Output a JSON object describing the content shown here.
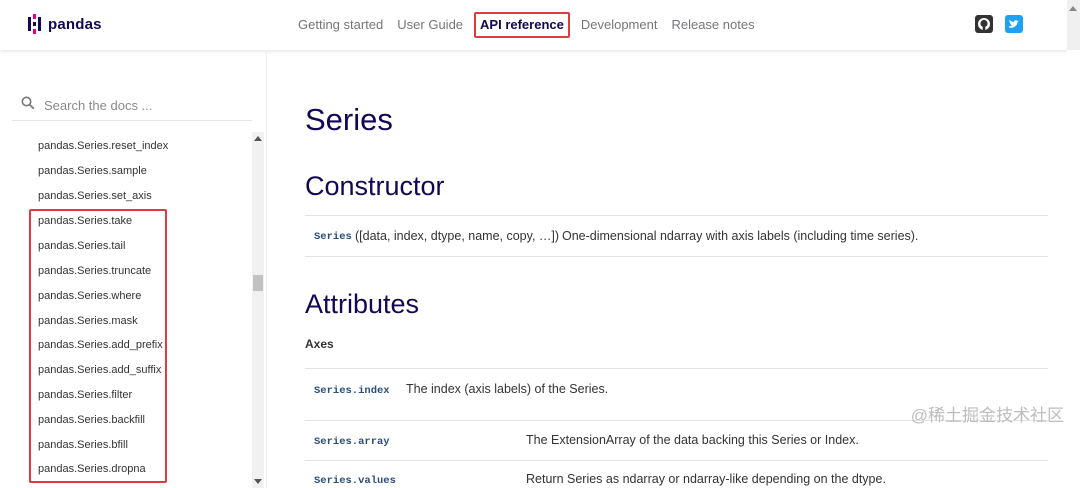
{
  "navbar": {
    "brand": "pandas",
    "links": [
      {
        "label": "Getting started",
        "active": false
      },
      {
        "label": "User Guide",
        "active": false
      },
      {
        "label": "API reference",
        "active": true
      },
      {
        "label": "Development",
        "active": false
      },
      {
        "label": "Release notes",
        "active": false
      }
    ],
    "social_icons": [
      "github-icon",
      "twitter-icon"
    ]
  },
  "sidebar": {
    "search_placeholder": "Search the docs ...",
    "items": [
      "pandas.Series.reset_index",
      "pandas.Series.sample",
      "pandas.Series.set_axis",
      "pandas.Series.take",
      "pandas.Series.tail",
      "pandas.Series.truncate",
      "pandas.Series.where",
      "pandas.Series.mask",
      "pandas.Series.add_prefix",
      "pandas.Series.add_suffix",
      "pandas.Series.filter",
      "pandas.Series.backfill",
      "pandas.Series.bfill",
      "pandas.Series.dropna"
    ]
  },
  "main": {
    "title": "Series",
    "constructor_heading": "Constructor",
    "constructor": {
      "name": "Series",
      "signature": "([data, index, dtype, name, copy, …])",
      "description": "One-dimensional ndarray with axis labels (including time series)."
    },
    "attributes_heading": "Attributes",
    "axes_label": "Axes",
    "attributes": [
      {
        "name": "Series.index",
        "description": "The index (axis labels) of the Series."
      },
      {
        "name": "Series.array",
        "description": "The ExtensionArray of the data backing this Series or Index."
      },
      {
        "name": "Series.values",
        "description": "Return Series as ndarray or ndarray-like depending on the dtype."
      }
    ]
  },
  "watermark": "@稀土掘金技术社区",
  "colors": {
    "brand": "#130654",
    "accent": "#e70488",
    "highlight": "#e0393e"
  }
}
